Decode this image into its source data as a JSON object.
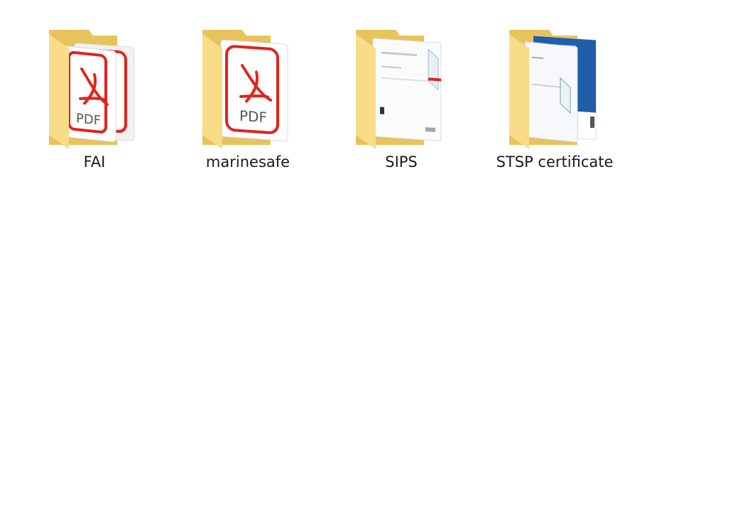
{
  "folders": [
    {
      "name": "FAI",
      "icon": "folder-pdf-stack-icon"
    },
    {
      "name": "marinesafe",
      "icon": "folder-pdf-icon"
    },
    {
      "name": "SIPS",
      "icon": "folder-certificate-preview-icon"
    },
    {
      "name": "STSP certificate",
      "icon": "folder-certificate-preview-icon"
    }
  ],
  "pdf_badge_text": "PDF",
  "colors": {
    "folder_back": "#e8c35c",
    "folder_front": "#f8dc88",
    "pdf_red": "#e3231b",
    "certificate_blue": "#1e5fa8"
  }
}
